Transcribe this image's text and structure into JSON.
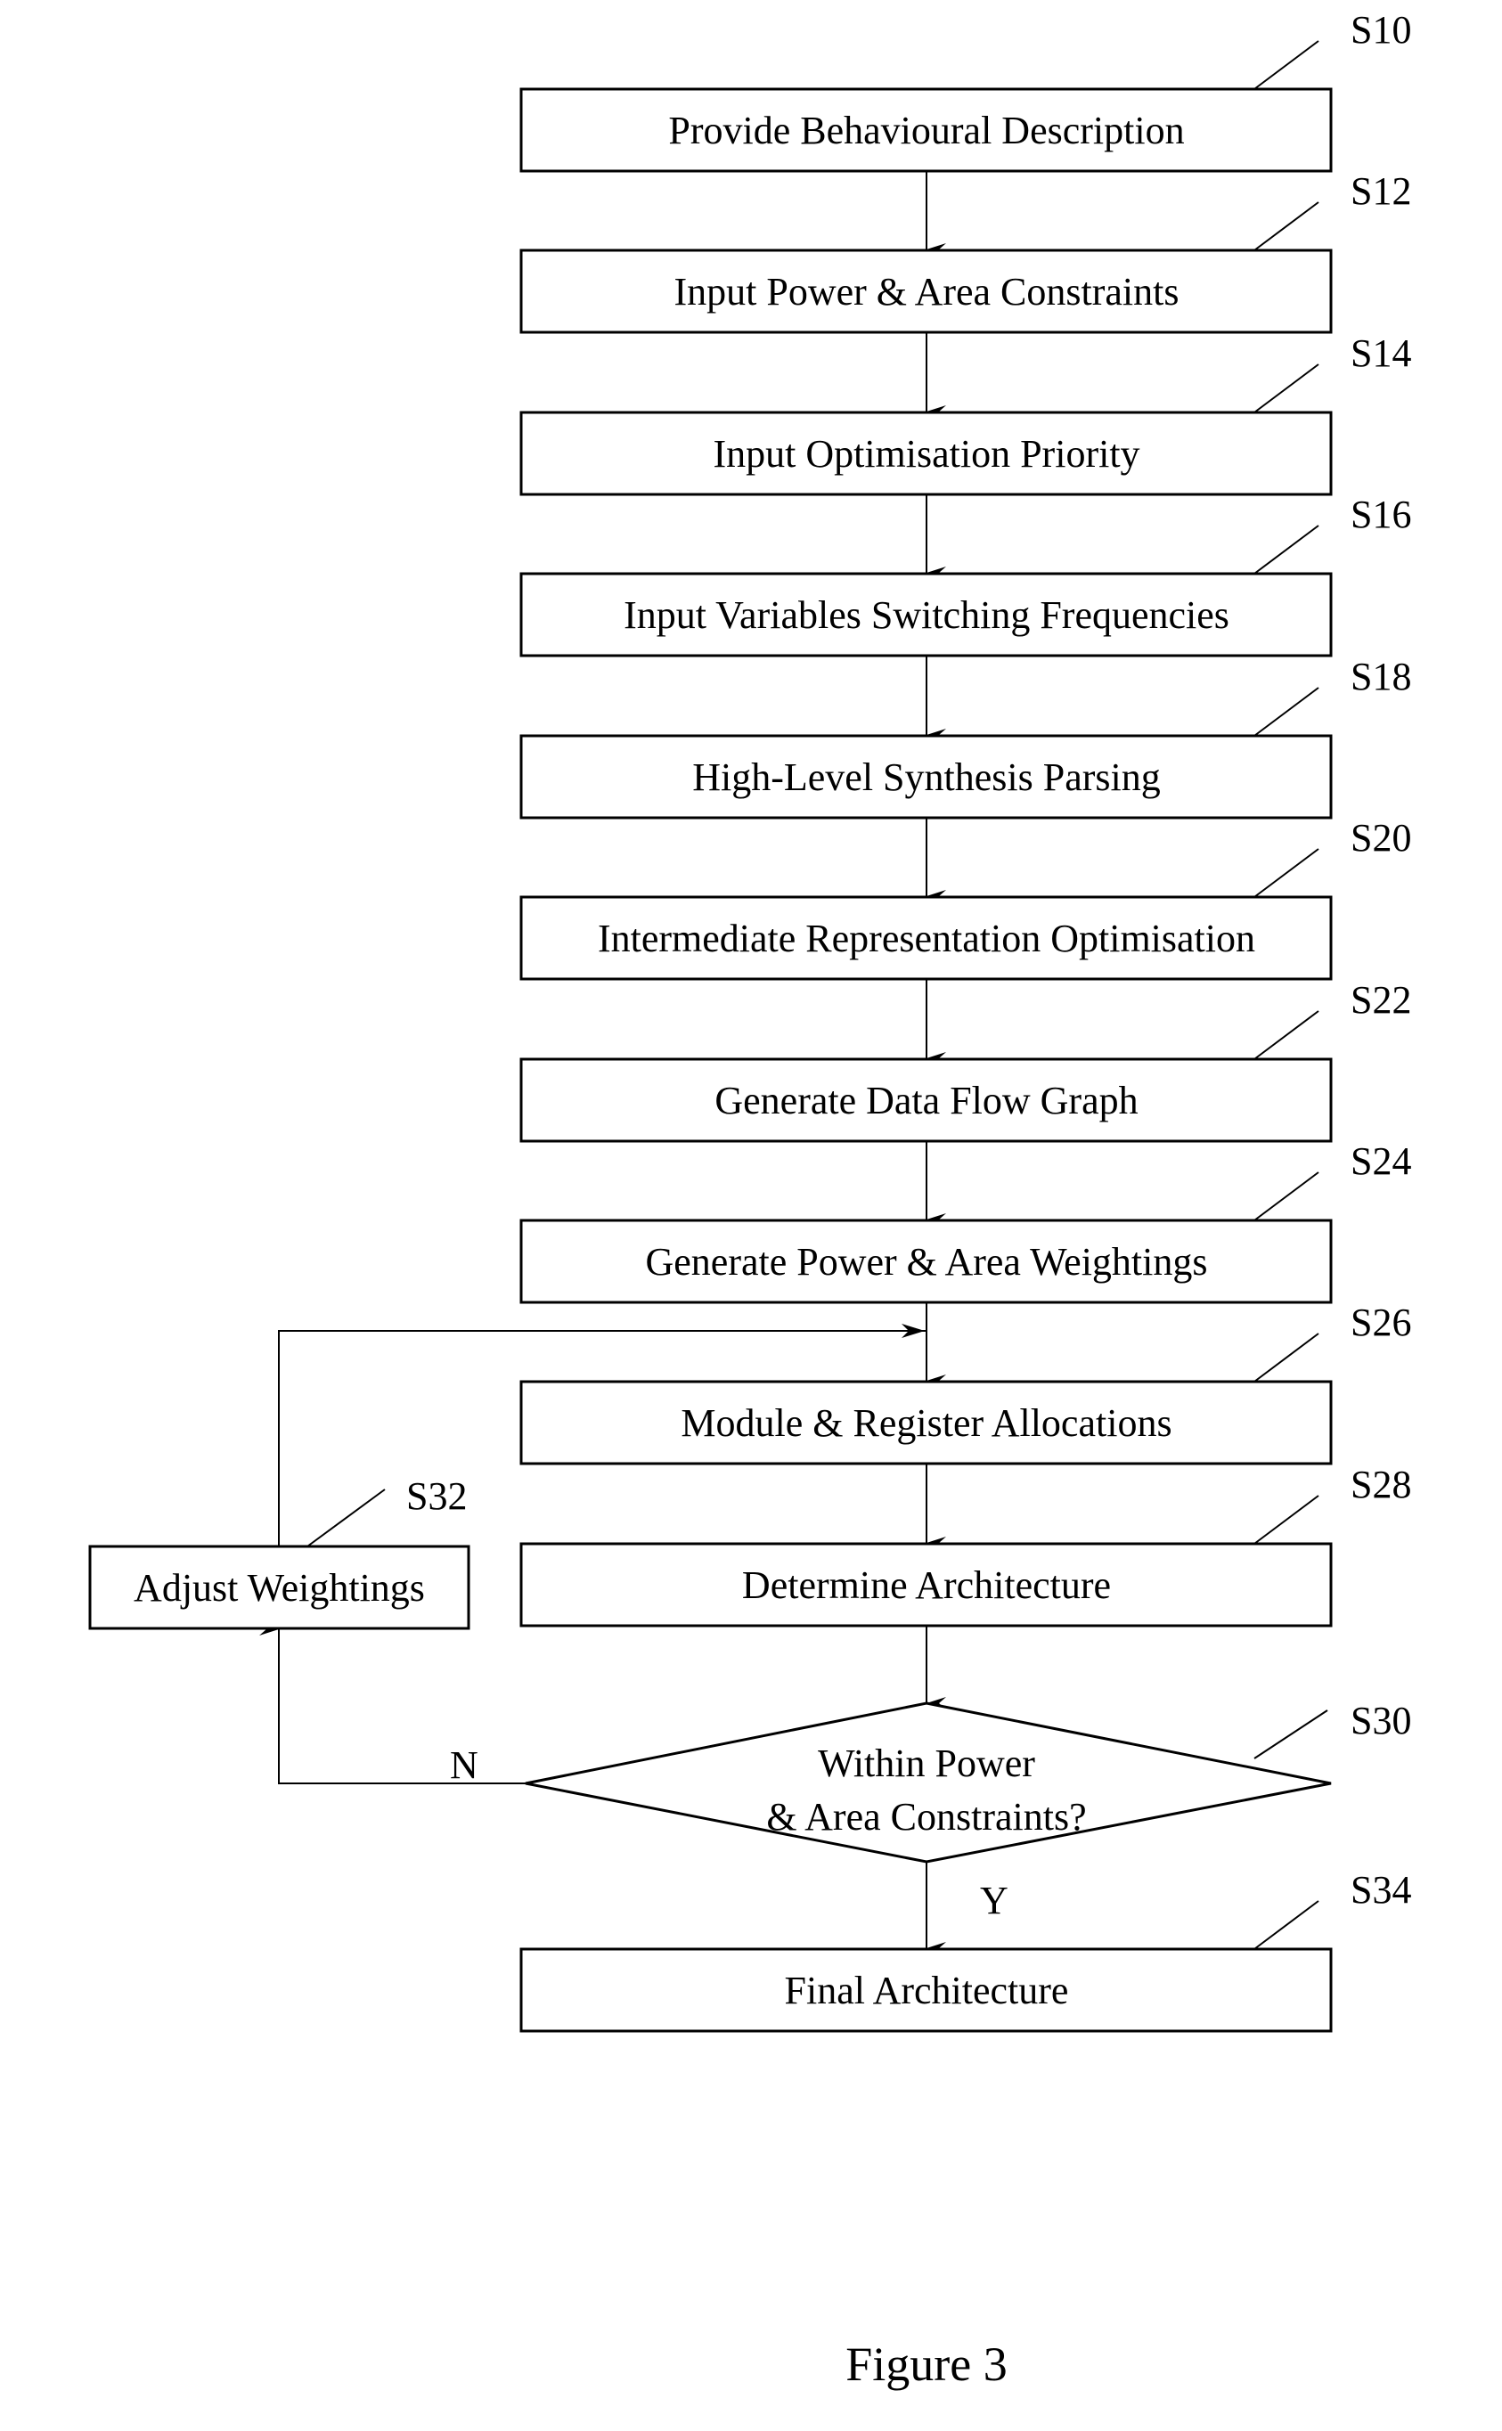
{
  "figure": {
    "caption": "Figure 3",
    "steps": [
      {
        "id": "S10",
        "label": "Provide Behavioural Description"
      },
      {
        "id": "S12",
        "label": "Input Power & Area Constraints"
      },
      {
        "id": "S14",
        "label": "Input Optimisation Priority"
      },
      {
        "id": "S16",
        "label": "Input Variables Switching Frequencies"
      },
      {
        "id": "S18",
        "label": "High-Level Synthesis Parsing"
      },
      {
        "id": "S20",
        "label": "Intermediate Representation Optimisation"
      },
      {
        "id": "S22",
        "label": "Generate Data Flow Graph"
      },
      {
        "id": "S24",
        "label": "Generate Power & Area Weightings"
      },
      {
        "id": "S26",
        "label": "Module & Register Allocations"
      },
      {
        "id": "S28",
        "label": "Determine Architecture"
      }
    ],
    "decision": {
      "id": "S30",
      "line1": "Within Power",
      "line2": "& Area Constraints?",
      "no_label": "N",
      "yes_label": "Y"
    },
    "adjust": {
      "id": "S32",
      "label": "Adjust Weightings"
    },
    "final": {
      "id": "S34",
      "label": "Final Architecture"
    }
  }
}
